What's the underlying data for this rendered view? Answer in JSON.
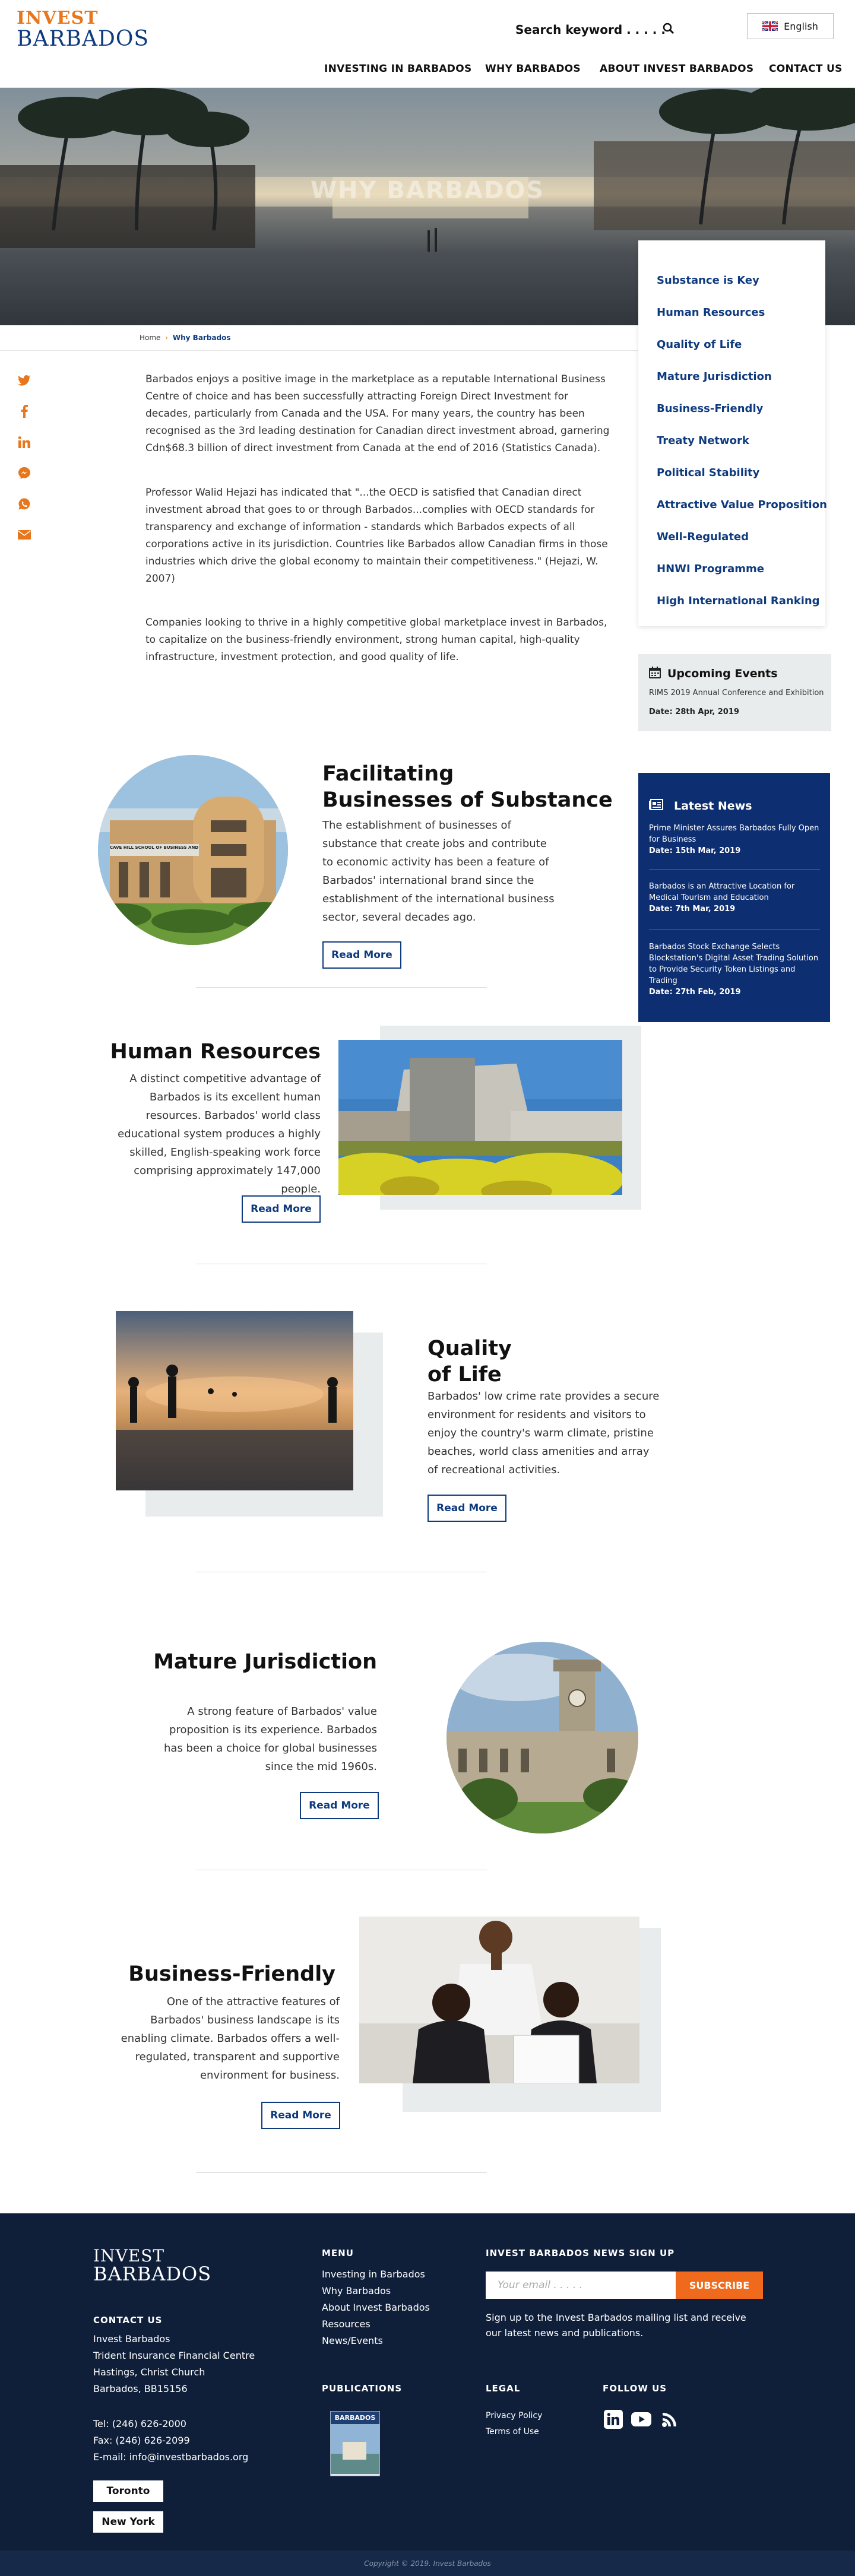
{
  "header": {
    "logo_top": "INVEST",
    "logo_bottom": "BARBADOS",
    "search_placeholder": "Search keyword . . . . .",
    "language": "English"
  },
  "nav": {
    "items": [
      "INVESTING IN BARBADOS",
      "WHY BARBADOS",
      "ABOUT INVEST BARBADOS",
      "CONTACT US"
    ]
  },
  "hero": {
    "title": "WHY BARBADOS"
  },
  "breadcrumb": {
    "home": "Home",
    "sep": "›",
    "current": "Why Barbados"
  },
  "sidenav": {
    "items": [
      "Substance is Key",
      "Human Resources",
      "Quality of Life",
      "Mature Jurisdiction",
      "Business-Friendly",
      "Treaty Network",
      "Political Stability",
      "Attractive Value Proposition",
      "Well-Regulated",
      "HNWI Programme",
      "High International Ranking"
    ]
  },
  "share": {
    "icons": [
      "twitter-icon",
      "facebook-icon",
      "linkedin-icon",
      "messenger-icon",
      "whatsapp-icon",
      "email-icon"
    ]
  },
  "intro": {
    "p1": "Barbados enjoys a positive image in the marketplace as a reputable International Business Centre of choice and has been successfully attracting Foreign Direct Investment for decades, particularly from Canada and the USA.  For many years, the country has been recognised as the 3rd leading destination for Canadian direct investment abroad, garnering Cdn$68.3 billion of direct investment from Canada at the end of 2016 (Statistics Canada).",
    "p2": "Professor Walid Hejazi has indicated that \"...the OECD is satisfied that Canadian direct investment abroad that goes to or through Barbados...complies with OECD standards for transparency and exchange of information - standards which Barbados expects of all corporations active in its jurisdiction. Countries like Barbados allow Canadian firms in those industries which drive the global economy to maintain their competitiveness.\" (Hejazi, W. 2007)",
    "p3": "Companies looking to thrive in a highly competitive global marketplace invest in Barbados, to capitalize on the business-friendly environment, strong human capital, high-quality infrastructure, investment protection, and good quality of life."
  },
  "events": {
    "heading": "Upcoming Events",
    "item_title": "RIMS 2019 Annual Conference and Exhibition",
    "item_date": "Date: 28th Apr, 2019"
  },
  "news": {
    "heading": "Latest News",
    "items": [
      {
        "title": "Prime Minister Assures Barbados Fully Open for Business",
        "date": "Date: 15th Mar, 2019"
      },
      {
        "title": "Barbados is an Attractive Location for Medical Tourism and Education",
        "date": "Date: 7th Mar, 2019"
      },
      {
        "title": "Barbados Stock Exchange Selects Blockstation's Digital Asset Trading Solution to Provide Security Token Listings and Trading",
        "date": "Date: 27th Feb, 2019"
      }
    ]
  },
  "sections": {
    "s1": {
      "title_1": "Facilitating",
      "title_2": "Businesses of Substance",
      "text": "The establishment of businesses of substance that create jobs and contribute to economic activity has been a feature of Barbados' international brand since the establishment of the international business sector, several decades ago.",
      "image_label": "CAVE HILL SCHOOL OF BUSINESS AND MANAGEMENT",
      "button": "Read More"
    },
    "s2": {
      "title": "Human Resources",
      "text": "A distinct competitive advantage of Barbados is its excellent human resources. Barbados' world class educational system produces a highly skilled, English-speaking work force comprising approximately 147,000 people.",
      "button": "Read More"
    },
    "s3": {
      "title_1": "Quality",
      "title_2": "of Life",
      "text": "Barbados' low crime rate provides a secure environment for residents and visitors to enjoy the country's warm climate, pristine beaches, world class amenities and array of recreational activities.",
      "button": "Read More"
    },
    "s4": {
      "title": "Mature Jurisdiction",
      "text": "A strong feature of Barbados' value proposition is its experience. Barbados has been a choice for global businesses since the mid 1960s.",
      "button": "Read More"
    },
    "s5": {
      "title": "Business-Friendly",
      "text": "One of the attractive features of Barbados' business landscape is its enabling climate. Barbados offers a well-regulated, transparent and supportive environment for business.",
      "button": "Read More"
    }
  },
  "footer": {
    "logo_top": "INVEST",
    "logo_bottom": "BARBADOS",
    "contact_heading": "CONTACT US",
    "address": [
      "Invest Barbados",
      "Trident Insurance Financial Centre",
      "Hastings, Christ Church",
      "Barbados, BB15156"
    ],
    "phone": "Tel: (246) 626-2000",
    "fax": "Fax: (246) 626-2099",
    "email": "E-mail: info@investbarbados.org",
    "office_buttons": [
      "Toronto",
      "New York"
    ],
    "menu_heading": "MENU",
    "menu_items": [
      "Investing in Barbados",
      "Why Barbados",
      "About Invest Barbados",
      "Resources",
      "News/Events"
    ],
    "publications_heading": "PUBLICATIONS",
    "publication_cover_title": "BARBADOS",
    "newsletter_heading": "INVEST BARBADOS NEWS SIGN UP",
    "email_placeholder": "Your email . . . . .",
    "subscribe": "SUBSCRIBE",
    "newsletter_text": "Sign up to the Invest Barbados mailing list and receive our latest  news and publications.",
    "legal_heading": "LEGAL",
    "legal_items": [
      "Privacy Policy",
      "Terms of Use"
    ],
    "follow_heading": "FOLLOW US",
    "social_icons": [
      "linkedin-icon",
      "youtube-icon",
      "rss-icon"
    ],
    "copyright": "Copyright © 2019. Invest Barbados"
  },
  "colors": {
    "navy": "#0e3a7e",
    "orange": "#e8761c",
    "footer_bg": "#0f1f3a",
    "news_bg": "#0d2e70"
  }
}
